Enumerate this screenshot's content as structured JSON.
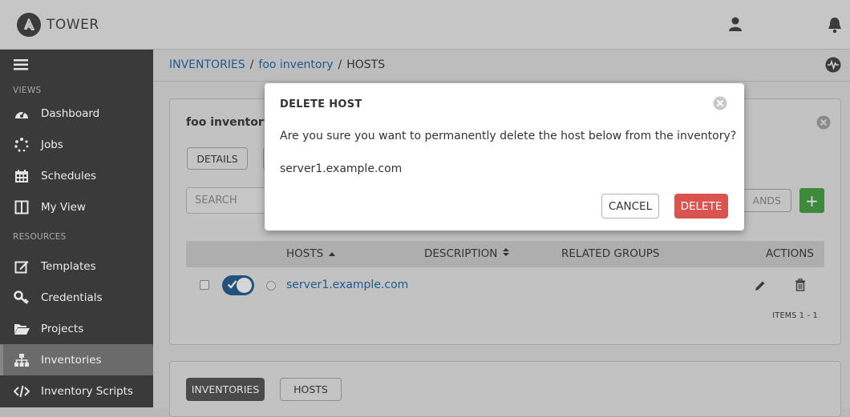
{
  "app": {
    "brand": "TOWER"
  },
  "sidebar": {
    "sections": {
      "views": "VIEWS",
      "resources": "RESOURCES"
    },
    "items": [
      {
        "label": "Dashboard",
        "icon": "dashboard-icon"
      },
      {
        "label": "Jobs",
        "icon": "jobs-icon"
      },
      {
        "label": "Schedules",
        "icon": "calendar-icon"
      },
      {
        "label": "My View",
        "icon": "columns-icon"
      },
      {
        "label": "Templates",
        "icon": "pencil-square-icon"
      },
      {
        "label": "Credentials",
        "icon": "key-icon"
      },
      {
        "label": "Projects",
        "icon": "folder-open-icon"
      },
      {
        "label": "Inventories",
        "icon": "sitemap-icon",
        "active": true
      },
      {
        "label": "Inventory Scripts",
        "icon": "code-icon"
      }
    ]
  },
  "breadcrumb": {
    "root": "INVENTORIES",
    "sep": "/",
    "middle": "foo inventory",
    "current": "HOSTS"
  },
  "panel": {
    "title": "foo inventory",
    "details_tab": "DETAILS",
    "search_placeholder": "SEARCH",
    "hidden_button_fragment": "ANDS",
    "add_label": "+"
  },
  "table": {
    "headers": {
      "hosts": "HOSTS",
      "description": "DESCRIPTION",
      "related_groups": "RELATED GROUPS",
      "actions": "ACTIONS"
    },
    "rows": [
      {
        "host": "server1.example.com",
        "enabled": true
      }
    ],
    "items_count": "ITEMS  1 - 1"
  },
  "bottom_panel": {
    "tabs": [
      "INVENTORIES",
      "HOSTS"
    ]
  },
  "modal": {
    "title": "DELETE HOST",
    "body": "Are you sure you want to permanently delete the host below from the inventory?",
    "host": "server1.example.com",
    "cancel": "CANCEL",
    "delete": "DELETE"
  },
  "colors": {
    "delete_button": "#d9534f",
    "link": "#1f5990",
    "toggle_on": "#24507d",
    "add_button": "#3d8a3d"
  }
}
